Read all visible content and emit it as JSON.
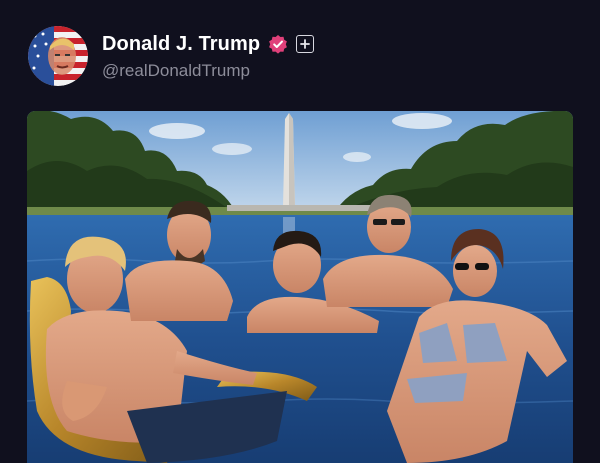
{
  "post": {
    "author": {
      "display_name": "Donald J. Trump",
      "handle": "@realDonaldTrump",
      "avatar_icon": "flag-portrait-avatar",
      "verified_icon": "verified-badge-icon",
      "follow_icon": "plus-icon"
    },
    "image": {
      "description_icon": "pool-photo"
    }
  },
  "colors": {
    "background": "#10101e",
    "handle_text": "#8d8d9a",
    "verified_badge": "#e0407a"
  }
}
